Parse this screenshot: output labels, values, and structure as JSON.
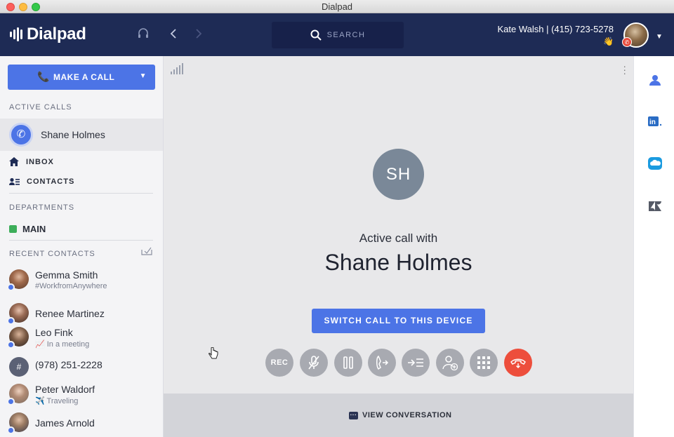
{
  "window": {
    "title": "Dialpad"
  },
  "topnav": {
    "logo_text": "Dialpad",
    "search_label": "SEARCH",
    "user_line": "Kate Walsh | (415) 723-5278",
    "user_status_emoji": "👋",
    "avatar_badge": "✆"
  },
  "sidebar": {
    "make_call_label": "MAKE A CALL",
    "active_calls_title": "ACTIVE CALLS",
    "active_call_name": "Shane Holmes",
    "inbox_label": "INBOX",
    "contacts_label": "CONTACTS",
    "departments_title": "DEPARTMENTS",
    "department_main": "MAIN",
    "recent_title": "RECENT CONTACTS",
    "recent": [
      {
        "name": "Gemma Smith",
        "status": "#WorkfromAnywhere",
        "avatar_color": "#8a5a3c"
      },
      {
        "name": "Renee Martinez",
        "status": "",
        "avatar_color": "#6b4a3a"
      },
      {
        "name": "Leo Fink",
        "status": "📈 In a meeting",
        "avatar_color": "#4a3b30"
      },
      {
        "name": "(978) 251-2228",
        "status": "",
        "avatar_color": "#5b6175",
        "avatar_text": "#"
      },
      {
        "name": "Peter Waldorf",
        "status": "✈️ Traveling",
        "avatar_color": "#9a8a7a"
      },
      {
        "name": "James Arnold",
        "status": "",
        "avatar_color": "#7a6a5a"
      }
    ]
  },
  "main": {
    "caller_initials": "SH",
    "active_with": "Active call with",
    "caller_name": "Shane Holmes",
    "switch_label": "SWITCH CALL TO THIS DEVICE",
    "controls": {
      "rec": "REC",
      "mute_icon": "🎙",
      "hold_icon": "❚❚",
      "transfer_icon": "↪",
      "forward_icon": "→≡",
      "add_icon": "+",
      "keypad_icon": "⠿",
      "hangup_icon": "☎"
    },
    "view_conversation": "VIEW CONVERSATION"
  },
  "colors": {
    "nav_bg": "#1e2b55",
    "accent": "#4c74e6",
    "hangup": "#ed4e3c",
    "dept_main": "#3dae5a"
  }
}
